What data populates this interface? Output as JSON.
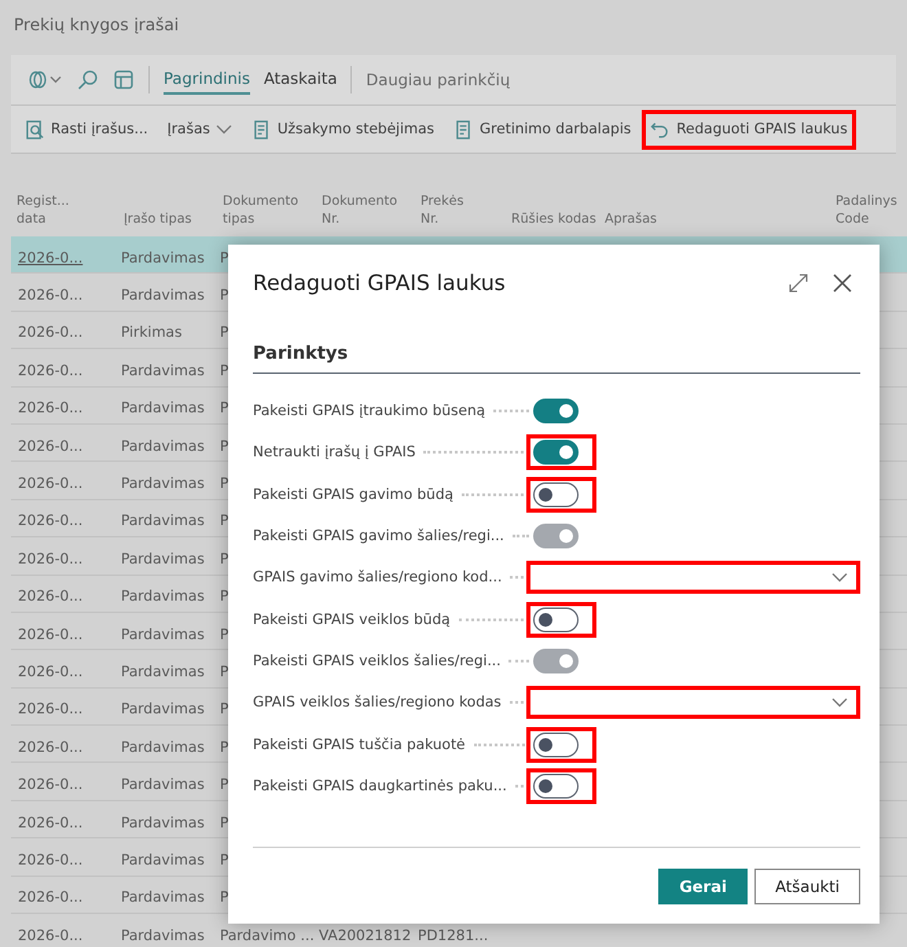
{
  "page": {
    "title": "Prekių knygos įrašai"
  },
  "toolbar": {
    "tabs": [
      {
        "label": "Pagrindinis",
        "selected": true
      },
      {
        "label": "Ataskaita",
        "selected": false
      }
    ],
    "more": "Daugiau parinkčių"
  },
  "actions": [
    {
      "label": "Rasti įrašus...",
      "highlighted": false
    },
    {
      "label": "Įrašas",
      "highlighted": false
    },
    {
      "label": "Užsakymo stebėjimas",
      "highlighted": false
    },
    {
      "label": "Gretinimo darbalapis",
      "highlighted": false
    },
    {
      "label": "Redaguoti GPAIS laukus",
      "highlighted": true
    }
  ],
  "table": {
    "columns": [
      "Regist...\ndata",
      "Įrašo tipas",
      "Dokumento\ntipas",
      "Dokumento\nNr.",
      "Prekės\nNr.",
      "Rūšies kodas",
      "Aprašas",
      "Padalinys\nCode"
    ],
    "rows": [
      {
        "cells": [
          "2026-0...",
          "Pardavimas",
          "P"
        ],
        "selected": true
      },
      {
        "cells": [
          "2026-0...",
          "Pardavimas",
          "P"
        ],
        "selected": false
      },
      {
        "cells": [
          "2026-0...",
          "Pirkimas",
          "P"
        ],
        "selected": false
      },
      {
        "cells": [
          "2026-0...",
          "Pardavimas",
          "P"
        ],
        "selected": false
      },
      {
        "cells": [
          "2026-0...",
          "Pardavimas",
          "P"
        ],
        "selected": false
      },
      {
        "cells": [
          "2026-0...",
          "Pardavimas",
          "P"
        ],
        "selected": false
      },
      {
        "cells": [
          "2026-0...",
          "Pardavimas",
          "P"
        ],
        "selected": false
      },
      {
        "cells": [
          "2026-0...",
          "Pardavimas",
          "P"
        ],
        "selected": false
      },
      {
        "cells": [
          "2026-0...",
          "Pardavimas",
          "P"
        ],
        "selected": false
      },
      {
        "cells": [
          "2026-0...",
          "Pardavimas",
          "P"
        ],
        "selected": false
      },
      {
        "cells": [
          "2026-0...",
          "Pardavimas",
          "P"
        ],
        "selected": false
      },
      {
        "cells": [
          "2026-0...",
          "Pardavimas",
          "P"
        ],
        "selected": false
      },
      {
        "cells": [
          "2026-0...",
          "Pardavimas",
          "P"
        ],
        "selected": false
      },
      {
        "cells": [
          "2026-0...",
          "Pardavimas",
          "P"
        ],
        "selected": false
      },
      {
        "cells": [
          "2026-0...",
          "Pardavimas",
          "P"
        ],
        "selected": false
      },
      {
        "cells": [
          "2026-0...",
          "Pardavimas",
          "P"
        ],
        "selected": false
      },
      {
        "cells": [
          "2026-0...",
          "Pardavimas",
          "P"
        ],
        "selected": false
      },
      {
        "cells": [
          "2026-0...",
          "Pardavimas",
          "P"
        ],
        "selected": false
      },
      {
        "cells": [
          "2026-0...",
          "Pardavimas",
          "Pardavimo ...",
          "VA20021812",
          "PD1281..."
        ],
        "selected": false
      }
    ]
  },
  "dialog": {
    "title": "Redaguoti GPAIS laukus",
    "section": "Parinktys",
    "fields": [
      {
        "kind": "toggle",
        "label": "Pakeisti GPAIS įtraukimo būseną",
        "on": true,
        "disabled": false,
        "highlighted": false
      },
      {
        "kind": "toggle",
        "label": "Netraukti įrašų į GPAIS",
        "on": true,
        "disabled": false,
        "highlighted": true
      },
      {
        "kind": "toggle",
        "label": "Pakeisti GPAIS gavimo būdą",
        "on": false,
        "disabled": false,
        "highlighted": true
      },
      {
        "kind": "toggle",
        "label": "Pakeisti GPAIS gavimo šalies/regi...",
        "on": true,
        "disabled": true,
        "highlighted": false
      },
      {
        "kind": "dropdown",
        "label": "GPAIS gavimo šalies/regiono kod...",
        "highlighted": true
      },
      {
        "kind": "toggle",
        "label": "Pakeisti GPAIS veiklos būdą",
        "on": false,
        "disabled": false,
        "highlighted": true
      },
      {
        "kind": "toggle",
        "label": "Pakeisti GPAIS veiklos šalies/regi...",
        "on": true,
        "disabled": true,
        "highlighted": false
      },
      {
        "kind": "dropdown",
        "label": "GPAIS veiklos šalies/regiono kodas",
        "highlighted": true
      },
      {
        "kind": "toggle",
        "label": "Pakeisti GPAIS tuščia pakuotė",
        "on": false,
        "disabled": false,
        "highlighted": true
      },
      {
        "kind": "toggle",
        "label": "Pakeisti GPAIS daugkartinės paku...",
        "on": false,
        "disabled": false,
        "highlighted": true
      }
    ],
    "buttons": [
      {
        "label": "Gerai",
        "kind": "primary"
      },
      {
        "label": "Atšaukti",
        "kind": "secondary"
      }
    ]
  }
}
